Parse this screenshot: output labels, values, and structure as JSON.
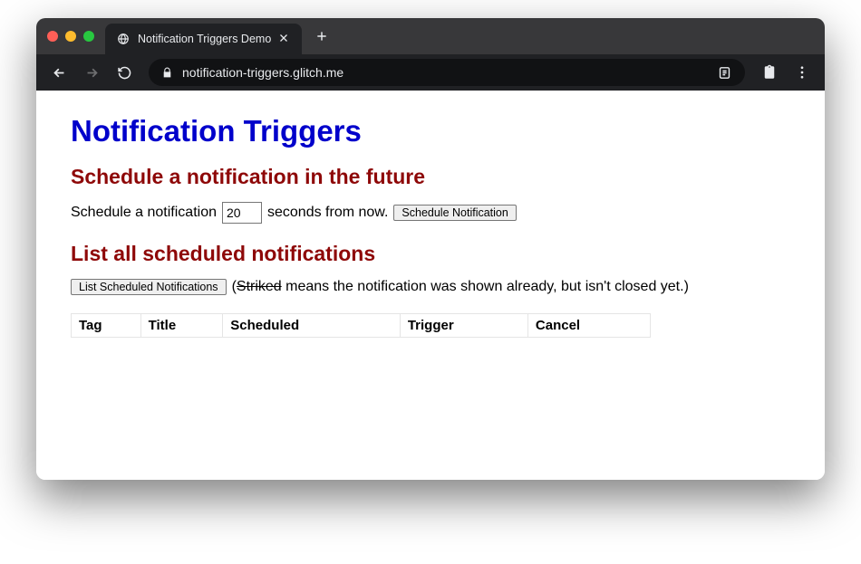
{
  "tab": {
    "title": "Notification Triggers Demo"
  },
  "address": {
    "url": "notification-triggers.glitch.me"
  },
  "page": {
    "heading": "Notification Triggers",
    "schedule": {
      "heading": "Schedule a notification in the future",
      "text_before": "Schedule a notification",
      "seconds_value": "20",
      "text_after": "seconds from now.",
      "button_label": "Schedule Notification"
    },
    "list": {
      "heading": "List all scheduled notifications",
      "button_label": "List Scheduled Notifications",
      "hint_open": "(",
      "hint_striked": "Striked",
      "hint_rest": " means the notification was shown already, but isn't closed yet.)",
      "columns": {
        "tag": "Tag",
        "title": "Title",
        "scheduled": "Scheduled",
        "trigger": "Trigger",
        "cancel": "Cancel"
      }
    }
  }
}
